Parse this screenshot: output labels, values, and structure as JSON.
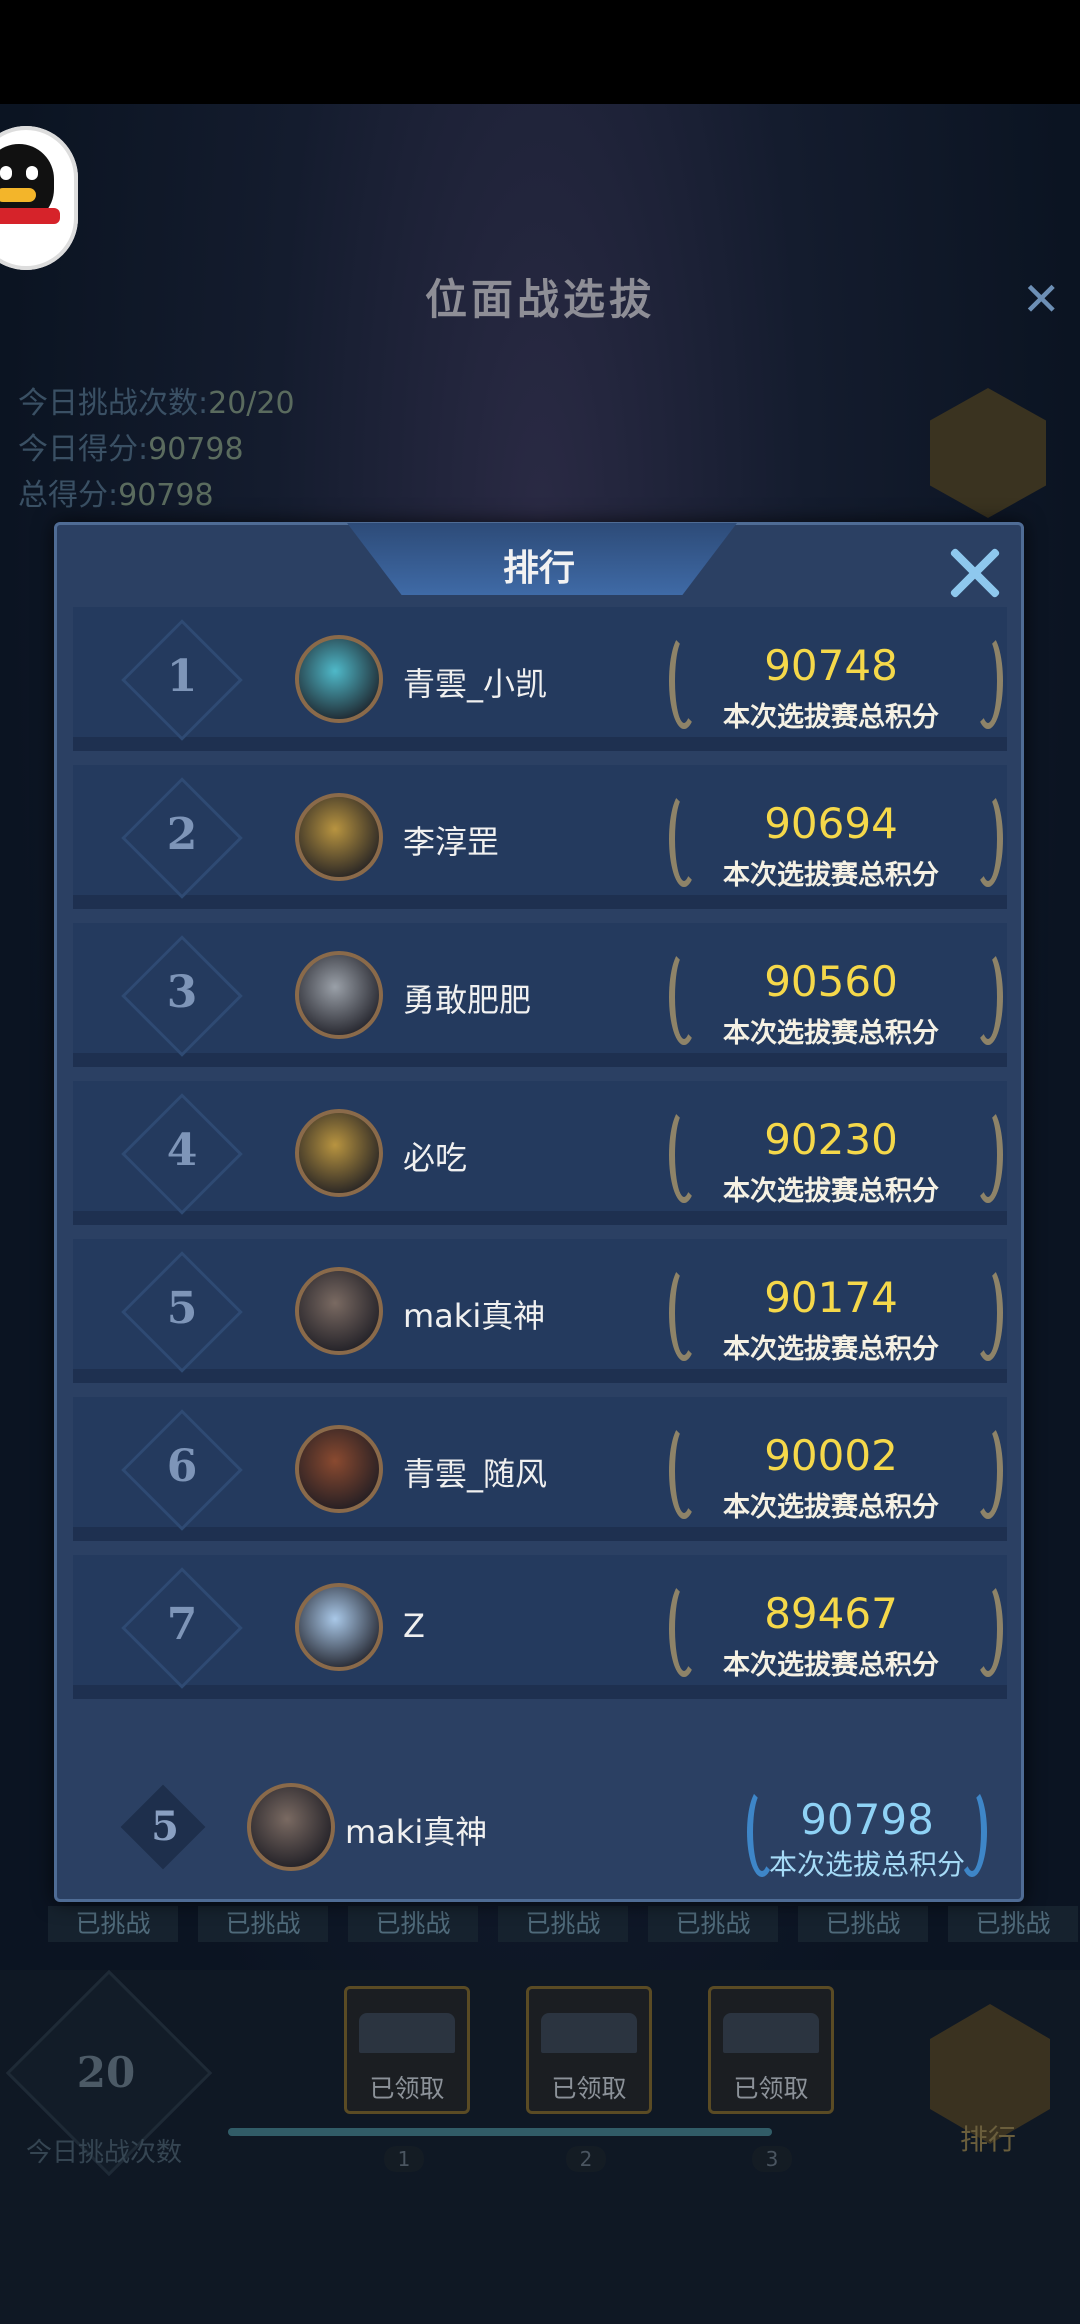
{
  "background": {
    "title": "位面战选拔",
    "stats": [
      {
        "label": "今日挑战次数:",
        "value": "20/20"
      },
      {
        "label": "今日得分:",
        "value": "90798"
      },
      {
        "label": "总得分:",
        "value": "90798"
      }
    ],
    "challenged_labels": [
      "已挑战",
      "已挑战",
      "已挑战",
      "已挑战",
      "已挑战",
      "已挑战",
      "已挑战"
    ],
    "today_count": "20",
    "today_count_label": "今日挑战次数",
    "chests": [
      {
        "label": "已领取",
        "step": "1"
      },
      {
        "label": "已领取",
        "step": "2"
      },
      {
        "label": "已领取",
        "step": "3"
      }
    ],
    "rank_button_label": "排行",
    "progress": 1.0
  },
  "modal": {
    "title": "排行",
    "score_label": "本次选拔赛总积分",
    "rows": [
      {
        "rank": "1",
        "name": "青雲_小凯",
        "score": "90748",
        "avatar_color": "#4fb9c9"
      },
      {
        "rank": "2",
        "name": "李淳罡",
        "score": "90694",
        "avatar_color": "#b89440"
      },
      {
        "rank": "3",
        "name": "勇敢肥肥",
        "score": "90560",
        "avatar_color": "#9aa0a8"
      },
      {
        "rank": "4",
        "name": "必吃",
        "score": "90230",
        "avatar_color": "#b89440"
      },
      {
        "rank": "5",
        "name": "maki真神",
        "score": "90174",
        "avatar_color": "#7a6a62"
      },
      {
        "rank": "6",
        "name": "青雲_随风",
        "score": "90002",
        "avatar_color": "#8a4a30"
      },
      {
        "rank": "7",
        "name": "Z",
        "score": "89467",
        "avatar_color": "#a9c8e8"
      }
    ],
    "mine": {
      "rank": "5",
      "name": "maki真神",
      "score": "90798",
      "label": "本次选拔总积分"
    }
  },
  "colors": {
    "score_gold": "#f5d84a",
    "my_score_blue": "#8fd2f5",
    "panel": "#2b4063"
  }
}
